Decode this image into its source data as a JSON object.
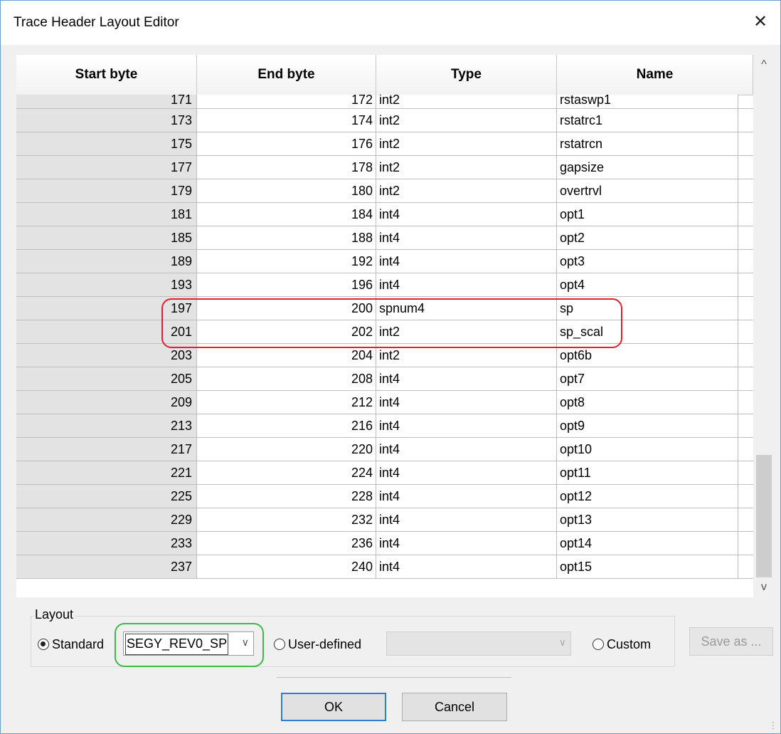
{
  "window": {
    "title": "Trace Header Layout Editor",
    "close_glyph": "✕"
  },
  "table": {
    "columns": [
      "Start byte",
      "End byte",
      "Type",
      "Name"
    ],
    "rows": [
      [
        "171",
        "172",
        "int2",
        "rstaswp1"
      ],
      [
        "173",
        "174",
        "int2",
        "rstatrc1"
      ],
      [
        "175",
        "176",
        "int2",
        "rstatrcn"
      ],
      [
        "177",
        "178",
        "int2",
        "gapsize"
      ],
      [
        "179",
        "180",
        "int2",
        "overtrvl"
      ],
      [
        "181",
        "184",
        "int4",
        "opt1"
      ],
      [
        "185",
        "188",
        "int4",
        "opt2"
      ],
      [
        "189",
        "192",
        "int4",
        "opt3"
      ],
      [
        "193",
        "196",
        "int4",
        "opt4"
      ],
      [
        "197",
        "200",
        "spnum4",
        "sp"
      ],
      [
        "201",
        "202",
        "int2",
        "sp_scal"
      ],
      [
        "203",
        "204",
        "int2",
        "opt6b"
      ],
      [
        "205",
        "208",
        "int4",
        "opt7"
      ],
      [
        "209",
        "212",
        "int4",
        "opt8"
      ],
      [
        "213",
        "216",
        "int4",
        "opt9"
      ],
      [
        "217",
        "220",
        "int4",
        "opt10"
      ],
      [
        "221",
        "224",
        "int4",
        "opt11"
      ],
      [
        "225",
        "228",
        "int4",
        "opt12"
      ],
      [
        "229",
        "232",
        "int4",
        "opt13"
      ],
      [
        "233",
        "236",
        "int4",
        "opt14"
      ],
      [
        "237",
        "240",
        "int4",
        "opt15"
      ]
    ]
  },
  "scroll": {
    "up_glyph": "^",
    "down_glyph": "v"
  },
  "layout": {
    "legend": "Layout",
    "standard_label": "Standard",
    "standard_value": "SEGY_REV0_SP",
    "user_defined_label": "User-defined",
    "user_defined_value": "",
    "custom_label": "Custom",
    "save_as_label": "Save as ...",
    "selected": "Standard"
  },
  "buttons": {
    "ok": "OK",
    "cancel": "Cancel"
  },
  "colors": {
    "highlight_red": "#e0202a",
    "highlight_green": "#3fb84a",
    "default_button_border": "#2f7bd8"
  }
}
